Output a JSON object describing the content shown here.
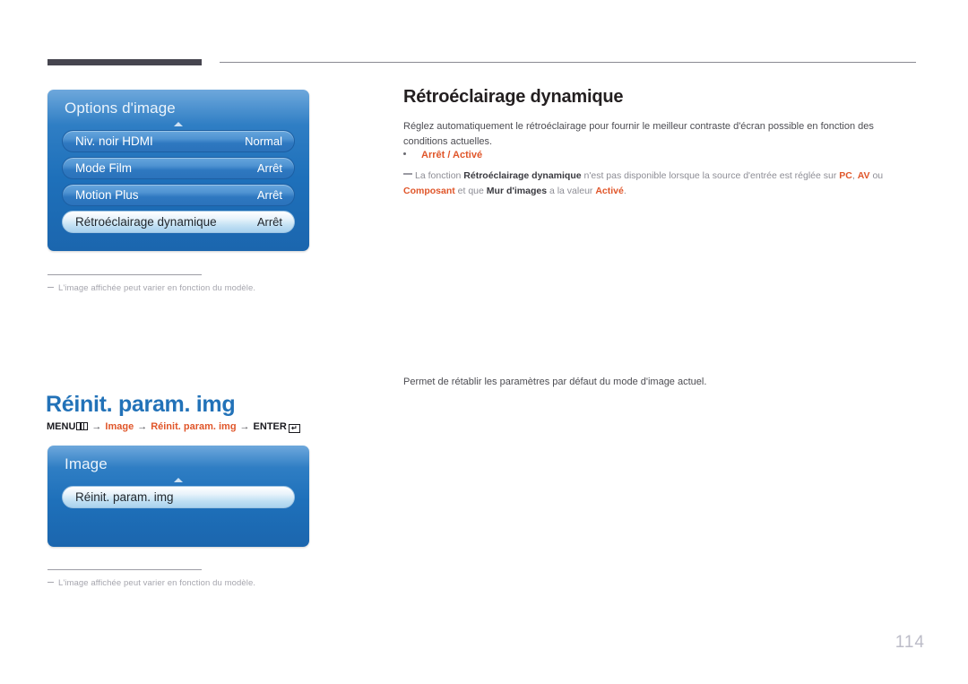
{
  "header": {
    "bar_color": "#46454f",
    "rule_color": "#8a8a92"
  },
  "osd_panel_1": {
    "title": "Options d'image",
    "rows": [
      {
        "label": "Niv. noir HDMI",
        "value": "Normal",
        "selected": false
      },
      {
        "label": "Mode Film",
        "value": "Arrêt",
        "selected": false
      },
      {
        "label": "Motion Plus",
        "value": "Arrêt",
        "selected": false
      },
      {
        "label": "Rétroéclairage dynamique",
        "value": "Arrêt",
        "selected": true
      }
    ]
  },
  "footnote_1": {
    "text": "L'image affichée peut varier en fonction du modèle."
  },
  "section_1": {
    "title": "Rétroéclairage dynamique",
    "body": "Réglez automatiquement le rétroéclairage pour fournir le meilleur contraste d'écran possible en fonction des conditions actuelles.",
    "bullet": "Arrêt / Activé",
    "note": {
      "part1": "La fonction ",
      "term1": "Rétroéclairage dynamique",
      "part2": " n'est pas disponible lorsque la source d'entrée est réglée sur ",
      "term2": "PC",
      "sep1": ", ",
      "term3": "AV",
      "part3": " ou ",
      "term4": "Composant",
      "part4": " et que ",
      "term5": "Mur d'images",
      "part5": " a la valeur ",
      "term6": "Activé",
      "part6": "."
    }
  },
  "section_2": {
    "title": "Réinit. param. img",
    "body": "Permet de rétablir les paramètres par défaut du mode d'image actuel.",
    "breadcrumb": {
      "menu": "MENU",
      "menu_icon": "menu-grid-icon",
      "arrow": "→",
      "step1": "Image",
      "step2": "Réinit. param. img",
      "enter": "ENTER",
      "enter_icon": "enter-return-icon",
      "enter_glyph": "↵"
    }
  },
  "osd_panel_2": {
    "title": "Image",
    "rows": [
      {
        "label": "Réinit. param. img",
        "value": "",
        "selected": true
      }
    ]
  },
  "footnote_2": {
    "text": "L'image affichée peut varier en fonction du modèle."
  },
  "page_number": "114",
  "colors": {
    "accent_orange": "#e0562a",
    "heading_blue": "#2272b8",
    "osd_blue": "#1e70ba",
    "page_number": "#bcbcc8"
  }
}
